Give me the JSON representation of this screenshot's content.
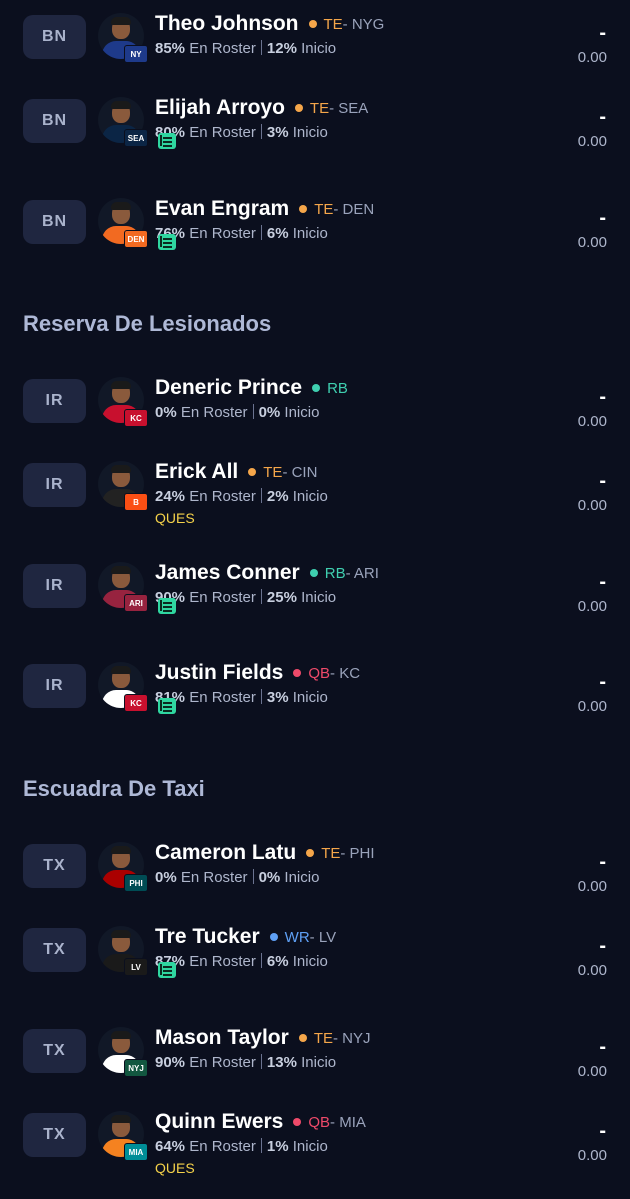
{
  "sections": [
    {
      "title": "Reserva De Lesionados"
    },
    {
      "title": "Escuadra De Taxi"
    }
  ],
  "players": [
    {
      "slot": "BN",
      "name": "Theo Johnson",
      "pos": "TE",
      "team": " - NYG",
      "pct_roster": "85%",
      "roster_label": "En Roster",
      "pct_start": "12%",
      "start_label": "Inicio",
      "proj_dash": "-",
      "proj": "0.00",
      "news": false,
      "status": "",
      "pos_color": "#f5a64a",
      "jersey_color": "#1e3a8a",
      "logo_color": "#1e3a8a",
      "logo_text": "NY"
    },
    {
      "slot": "BN",
      "name": "Elijah Arroyo",
      "pos": "TE",
      "team": " - SEA",
      "pct_roster": "80%",
      "roster_label": "En Roster",
      "pct_start": "3%",
      "start_label": "Inicio",
      "proj_dash": "-",
      "proj": "0.00",
      "news": true,
      "status": "",
      "pos_color": "#f5a64a",
      "jersey_color": "#0b2545",
      "logo_color": "#0b2545",
      "logo_text": "SEA"
    },
    {
      "slot": "BN",
      "name": "Evan Engram",
      "pos": "TE",
      "team": " - DEN",
      "pct_roster": "76%",
      "roster_label": "En Roster",
      "pct_start": "6%",
      "start_label": "Inicio",
      "proj_dash": "-",
      "proj": "0.00",
      "news": true,
      "status": "",
      "pos_color": "#f5a64a",
      "jersey_color": "#f26a21",
      "logo_color": "#f26a21",
      "logo_text": "DEN"
    },
    {
      "slot": "IR",
      "name": "Deneric Prince",
      "pos": "RB",
      "team": "",
      "pct_roster": "0%",
      "roster_label": "En Roster",
      "pct_start": "0%",
      "start_label": "Inicio",
      "proj_dash": "-",
      "proj": "0.00",
      "news": false,
      "status": "",
      "pos_color": "#3fcfb0",
      "jersey_color": "#c8102e",
      "logo_color": "#c8102e",
      "logo_text": "KC"
    },
    {
      "slot": "IR",
      "name": "Erick All",
      "pos": "TE",
      "team": " - CIN",
      "pct_roster": "24%",
      "roster_label": "En Roster",
      "pct_start": "2%",
      "start_label": "Inicio",
      "proj_dash": "-",
      "proj": "0.00",
      "news": false,
      "status": "QUES",
      "pos_color": "#f5a64a",
      "jersey_color": "#222222",
      "logo_color": "#fb4f14",
      "logo_text": "B"
    },
    {
      "slot": "IR",
      "name": "James Conner",
      "pos": "RB",
      "team": " - ARI",
      "pct_roster": "90%",
      "roster_label": "En Roster",
      "pct_start": "25%",
      "start_label": "Inicio",
      "proj_dash": "-",
      "proj": "0.00",
      "news": true,
      "status": "",
      "pos_color": "#3fcfb0",
      "jersey_color": "#97233f",
      "logo_color": "#97233f",
      "logo_text": "ARI"
    },
    {
      "slot": "IR",
      "name": "Justin Fields",
      "pos": "QB",
      "team": " - KC",
      "pct_roster": "81%",
      "roster_label": "En Roster",
      "pct_start": "3%",
      "start_label": "Inicio",
      "proj_dash": "-",
      "proj": "0.00",
      "news": true,
      "status": "",
      "pos_color": "#ef4a6a",
      "jersey_color": "#ffffff",
      "logo_color": "#c8102e",
      "logo_text": "KC"
    },
    {
      "slot": "TX",
      "name": "Cameron Latu",
      "pos": "TE",
      "team": " - PHI",
      "pct_roster": "0%",
      "roster_label": "En Roster",
      "pct_start": "0%",
      "start_label": "Inicio",
      "proj_dash": "-",
      "proj": "0.00",
      "news": false,
      "status": "",
      "pos_color": "#f5a64a",
      "jersey_color": "#aa0000",
      "logo_color": "#004c54",
      "logo_text": "PHI"
    },
    {
      "slot": "TX",
      "name": "Tre Tucker",
      "pos": "WR",
      "team": " - LV",
      "pct_roster": "87%",
      "roster_label": "En Roster",
      "pct_start": "6%",
      "start_label": "Inicio",
      "proj_dash": "-",
      "proj": "0.00",
      "news": true,
      "status": "",
      "pos_color": "#5fa0f5",
      "jersey_color": "#1a1a1a",
      "logo_color": "#1a1a1a",
      "logo_text": "LV"
    },
    {
      "slot": "TX",
      "name": "Mason Taylor",
      "pos": "TE",
      "team": " - NYJ",
      "pct_roster": "90%",
      "roster_label": "En Roster",
      "pct_start": "13%",
      "start_label": "Inicio",
      "proj_dash": "-",
      "proj": "0.00",
      "news": false,
      "status": "",
      "pos_color": "#f5a64a",
      "jersey_color": "#ffffff",
      "logo_color": "#125740",
      "logo_text": "NYJ"
    },
    {
      "slot": "TX",
      "name": "Quinn Ewers",
      "pos": "QB",
      "team": " - MIA",
      "pct_roster": "64%",
      "roster_label": "En Roster",
      "pct_start": "1%",
      "start_label": "Inicio",
      "proj_dash": "-",
      "proj": "0.00",
      "news": false,
      "status": "QUES",
      "pos_color": "#ef4a6a",
      "jersey_color": "#f58220",
      "logo_color": "#008e97",
      "logo_text": "MIA"
    }
  ]
}
